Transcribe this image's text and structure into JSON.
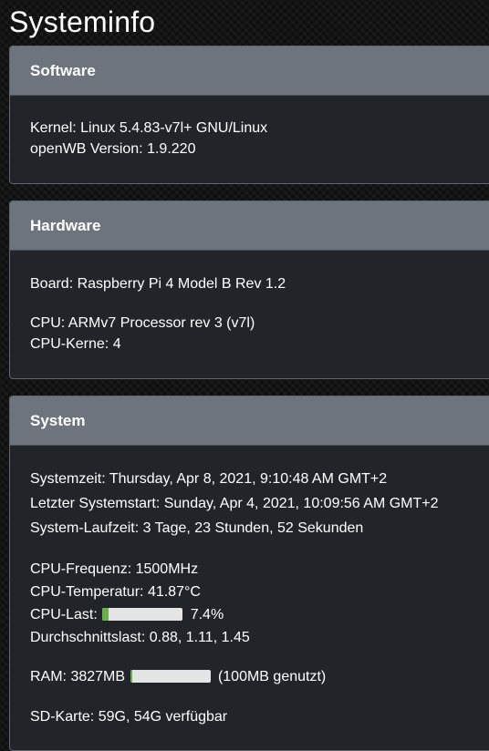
{
  "page": {
    "title": "Systeminfo"
  },
  "software": {
    "header": "Software",
    "kernel_label": "Kernel:",
    "kernel_value": "Linux 5.4.83-v7l+ GNU/Linux",
    "version_label": "openWB Version:",
    "version_value": "1.9.220"
  },
  "hardware": {
    "header": "Hardware",
    "board_label": "Board:",
    "board_value": "Raspberry Pi 4 Model B Rev 1.2",
    "cpu_label": "CPU:",
    "cpu_value": "ARMv7 Processor rev 3 (v7l)",
    "cores_label": "CPU-Kerne:",
    "cores_value": "4"
  },
  "system": {
    "header": "System",
    "time_label": "Systemzeit:",
    "time_value": "Thursday, Apr 8, 2021, 9:10:48 AM GMT+2",
    "boot_label": "Letzter Systemstart:",
    "boot_value": "Sunday, Apr 4, 2021, 10:09:56 AM GMT+2",
    "uptime_label": "System-Laufzeit:",
    "uptime_value": "3 Tage, 23 Stunden, 52 Sekunden",
    "freq_label": "CPU-Frequenz:",
    "freq_value": "1500MHz",
    "temp_label": "CPU-Temperatur:",
    "temp_value": "41.87°C",
    "load_label": "CPU-Last:",
    "load_value": "7.4%",
    "load_fraction": 0.074,
    "avg_label": "Durchschnittslast:",
    "avg_value": "0.88, 1.11, 1.45",
    "ram_label": "RAM:",
    "ram_value": "3827MB",
    "ram_used_text": "(100MB genutzt)",
    "ram_fraction": 0.026,
    "sd_label": "SD-Karte:",
    "sd_value": "59G, 54G verfügbar"
  },
  "colors": {
    "card_background": "#21252a",
    "card_header": "#6c757d",
    "bar_fill": "#6ab04c",
    "bar_track": "#e4e4e4"
  }
}
